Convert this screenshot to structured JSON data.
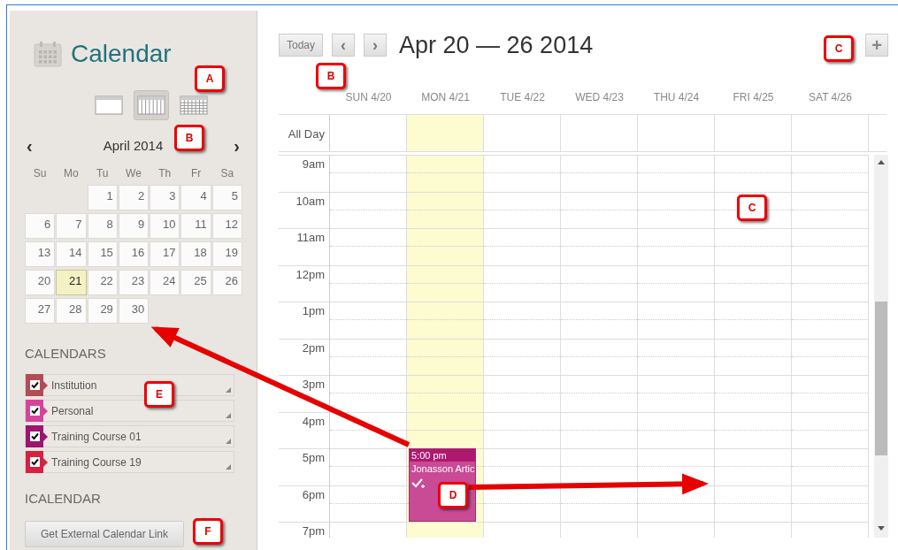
{
  "sidebar": {
    "title": "Calendar",
    "views": [
      {
        "kind": "day",
        "selected": false
      },
      {
        "kind": "week",
        "selected": true
      },
      {
        "kind": "month",
        "selected": false
      }
    ],
    "mini_calendar": {
      "prev": "‹",
      "month": "April 2014",
      "next": "›",
      "weekdays": [
        "Su",
        "Mo",
        "Tu",
        "We",
        "Th",
        "Fr",
        "Sa"
      ],
      "weeks": [
        [
          {
            "day": "1",
            "selected": false
          },
          {
            "day": "2",
            "selected": false
          },
          {
            "day": "3",
            "selected": false
          },
          {
            "day": "4",
            "selected": false
          },
          {
            "day": "5",
            "selected": false
          }
        ],
        [
          {
            "day": "6",
            "selected": false
          },
          {
            "day": "7",
            "selected": false
          },
          {
            "day": "8",
            "selected": false
          },
          {
            "day": "9",
            "selected": false
          },
          {
            "day": "10",
            "selected": false
          },
          {
            "day": "11",
            "selected": false
          },
          {
            "day": "12",
            "selected": false
          }
        ],
        [
          {
            "day": "13",
            "selected": false
          },
          {
            "day": "14",
            "selected": false
          },
          {
            "day": "15",
            "selected": false
          },
          {
            "day": "16",
            "selected": false
          },
          {
            "day": "17",
            "selected": false
          },
          {
            "day": "18",
            "selected": false
          },
          {
            "day": "19",
            "selected": false
          }
        ],
        [
          {
            "day": "20",
            "selected": false
          },
          {
            "day": "21",
            "selected": true
          },
          {
            "day": "22",
            "selected": false
          },
          {
            "day": "23",
            "selected": false
          },
          {
            "day": "24",
            "selected": false
          },
          {
            "day": "25",
            "selected": false
          },
          {
            "day": "26",
            "selected": false
          }
        ],
        [
          {
            "day": "27",
            "selected": false
          },
          {
            "day": "28",
            "selected": false
          },
          {
            "day": "29",
            "selected": false
          },
          {
            "day": "30",
            "selected": false
          }
        ]
      ]
    },
    "calendars_heading": "CALENDARS",
    "calendars": [
      {
        "name": "Institution",
        "checked": true,
        "color": "#b34b55"
      },
      {
        "name": "Personal",
        "checked": true,
        "color": "#d6449a"
      },
      {
        "name": "Training Course 01",
        "checked": true,
        "color": "#9e1470"
      },
      {
        "name": "Training Course 19",
        "checked": true,
        "color": "#d9213f"
      }
    ],
    "icalendar_heading": "ICALENDAR",
    "link_button": "Get External Calendar Link"
  },
  "toolbar": {
    "today": "Today",
    "prev": "‹",
    "next": "›",
    "range": "Apr 20 — 26 2014",
    "add": "+"
  },
  "week": {
    "all_day": "All Day",
    "days": [
      {
        "label": "SUN 4/20",
        "today": false
      },
      {
        "label": "MON 4/21",
        "today": true,
        "events": [
          {
            "time": "5:00 pm",
            "title": "Jonasson Artic",
            "color": "#c94a95"
          }
        ]
      },
      {
        "label": "TUE 4/22",
        "today": false
      },
      {
        "label": "WED 4/23",
        "today": false
      },
      {
        "label": "THU 4/24",
        "today": false
      },
      {
        "label": "FRI 4/25",
        "today": false
      },
      {
        "label": "SAT 4/26",
        "today": false
      }
    ],
    "hours": [
      "9am",
      "10am",
      "11am",
      "12pm",
      "1pm",
      "2pm",
      "3pm",
      "4pm",
      "5pm",
      "6pm",
      "7pm"
    ]
  },
  "callouts": [
    {
      "label": "A"
    },
    {
      "label": "B"
    },
    {
      "label": "B"
    },
    {
      "label": "C"
    },
    {
      "label": "C"
    },
    {
      "label": "D"
    },
    {
      "label": "E"
    },
    {
      "label": "F"
    }
  ]
}
